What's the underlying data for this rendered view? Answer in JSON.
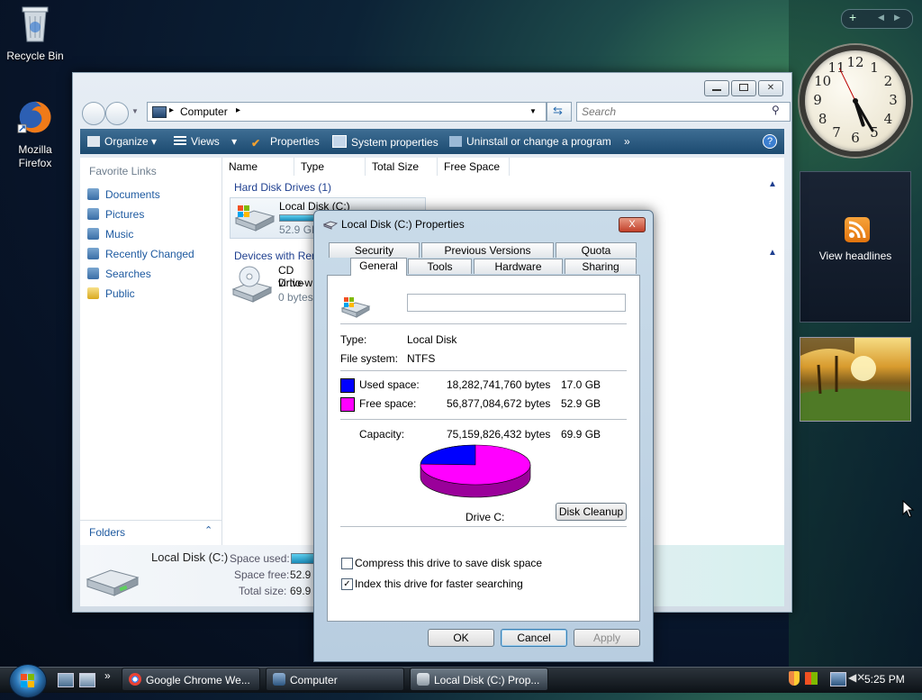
{
  "desktop": {
    "icons": [
      {
        "label": "Recycle Bin"
      },
      {
        "label": "Mozilla Firefox"
      }
    ]
  },
  "sidebar": {
    "feeds_label": "View headlines",
    "clock_numbers": [
      "12",
      "1",
      "2",
      "3",
      "4",
      "5",
      "6",
      "7",
      "8",
      "9",
      "10",
      "11"
    ]
  },
  "explorer": {
    "address": "Computer",
    "search_placeholder": "Search",
    "toolbar": {
      "organize": "Organize",
      "views": "Views",
      "properties": "Properties",
      "system_properties": "System properties",
      "uninstall": "Uninstall or change a program",
      "more": "»"
    },
    "favorite_links_header": "Favorite Links",
    "links": [
      "Documents",
      "Pictures",
      "Music",
      "Recently Changed",
      "Searches",
      "Public"
    ],
    "folders_label": "Folders",
    "columns": [
      "Name",
      "Type",
      "Total Size",
      "Free Space"
    ],
    "group_hard_disks": "Hard Disk Drives (1)",
    "local_disk_name": "Local Disk (C:)",
    "local_disk_free": "52.9 GB",
    "group_removable": "Devices with Ren",
    "cd_line1": "CD Drive",
    "cd_line2": "virtio-w",
    "cd_line3": "0 bytes",
    "details": {
      "name": "Local Disk (C:)",
      "space_used_label": "Space used:",
      "space_free_label": "Space free:",
      "space_free_value": "52.9 G",
      "total_size_label": "Total size:",
      "total_size_value": "69.9 G"
    }
  },
  "dialog": {
    "title": "Local Disk (C:) Properties",
    "close": "X",
    "tabs_back": [
      "Security",
      "Previous Versions",
      "Quota"
    ],
    "tabs_front": [
      "General",
      "Tools",
      "Hardware",
      "Sharing"
    ],
    "volume_label_value": "",
    "type_label": "Type:",
    "type_value": "Local Disk",
    "fs_label": "File system:",
    "fs_value": "NTFS",
    "used_label": "Used space:",
    "used_bytes": "18,282,741,760 bytes",
    "used_gb": "17.0 GB",
    "free_label": "Free space:",
    "free_bytes": "56,877,084,672 bytes",
    "free_gb": "52.9 GB",
    "capacity_label": "Capacity:",
    "capacity_bytes": "75,159,826,432 bytes",
    "capacity_gb": "69.9 GB",
    "drive_label": "Drive C:",
    "disk_cleanup": "Disk Cleanup",
    "compress_label": "Compress this drive to save disk space",
    "compress_checked": false,
    "index_label": "Index this drive for faster searching",
    "index_checked": true,
    "ok": "OK",
    "cancel": "Cancel",
    "apply": "Apply",
    "used_fraction": 0.243,
    "colors": {
      "used": "#0000ff",
      "free": "#ff00ff"
    }
  },
  "taskbar": {
    "tasks": [
      "Google Chrome We...",
      "Computer",
      "Local Disk (C:) Prop..."
    ],
    "clock": "5:25 PM",
    "quick_more": "»"
  }
}
